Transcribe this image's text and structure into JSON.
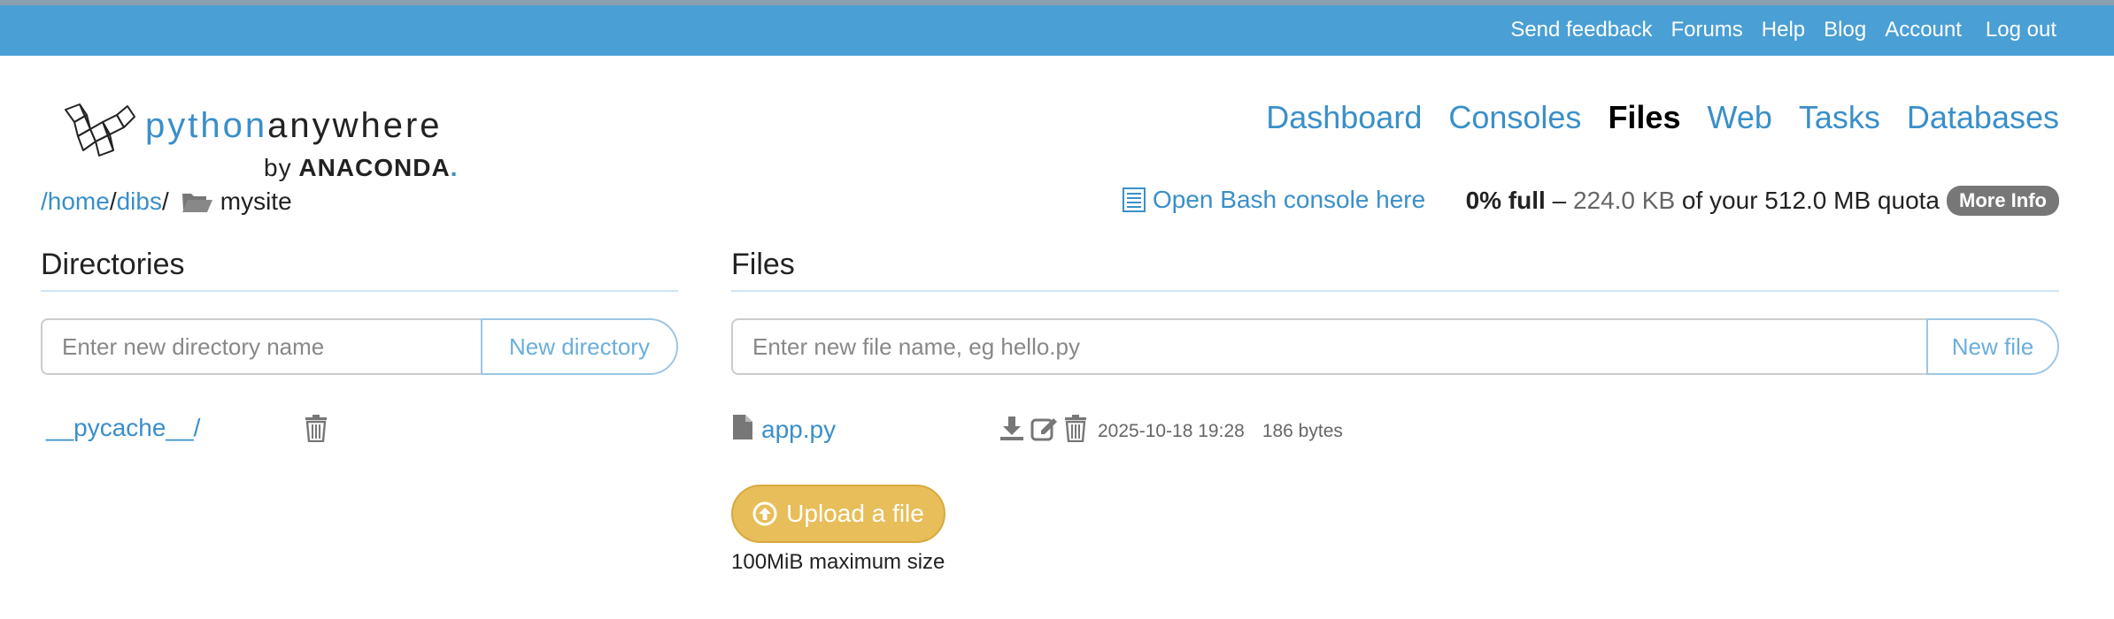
{
  "topbar": {
    "links": [
      "Send feedback",
      "Forums",
      "Help",
      "Blog",
      "Account",
      "Log out"
    ]
  },
  "logo": {
    "python": "python",
    "anywhere": "anywhere",
    "by": "by",
    "anaconda": "ANACONDA",
    "dot": "."
  },
  "nav": {
    "dashboard": "Dashboard",
    "consoles": "Consoles",
    "files": "Files",
    "web": "Web",
    "tasks": "Tasks",
    "databases": "Databases"
  },
  "breadcrumb": {
    "home": "/home",
    "sep1": "/",
    "user": "dibs",
    "sep2": "/",
    "current": "mysite"
  },
  "bash": {
    "label": "Open Bash console here"
  },
  "quota": {
    "percent": "0% full",
    "dash": " – ",
    "used": "224.0 KB",
    "of_text": " of your 512.0 MB quota",
    "more_info": "More Info"
  },
  "directories": {
    "title": "Directories",
    "placeholder": "Enter new directory name",
    "button": "New directory",
    "items": [
      {
        "name": "__pycache__/"
      }
    ]
  },
  "files": {
    "title": "Files",
    "placeholder": "Enter new file name, eg hello.py",
    "button": "New file",
    "items": [
      {
        "name": "app.py",
        "modified": "2025-10-18 19:28",
        "size": "186 bytes"
      }
    ]
  },
  "upload": {
    "button": "Upload a file",
    "max_size": "100MiB maximum size"
  }
}
